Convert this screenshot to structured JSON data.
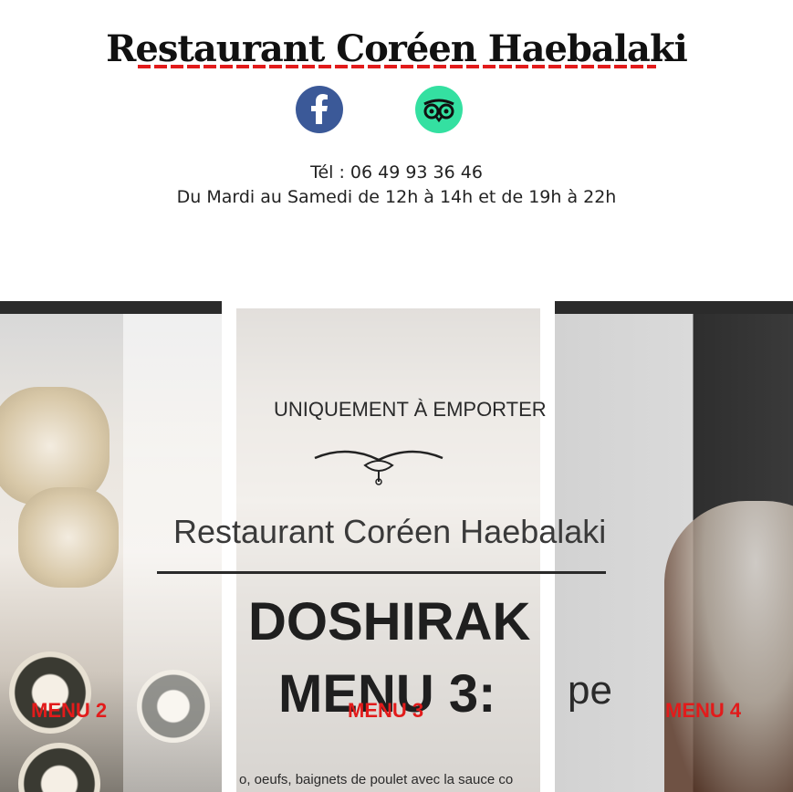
{
  "header": {
    "title": "Restaurant Coréen Haebalaki",
    "phone": "Tél : 06 49 93 36 46",
    "hours": "Du Mardi au Samedi de 12h à 14h et de 19h à 22h"
  },
  "social": [
    {
      "name": "facebook-icon",
      "glyph": "f",
      "color": "#3b5998"
    },
    {
      "name": "tripadvisor-icon",
      "glyph": "owl",
      "color": "#34e0a1"
    }
  ],
  "gallery": {
    "overlay": {
      "takeaway": "UNIQUEMENT À EMPORTER",
      "restaurant": "Restaurant Coréen Haebalaki",
      "doshirak": "DOSHIRAK",
      "menu_heading": "MENU 3:",
      "partial_word": "pe",
      "description": "o, oeufs, baignets de poulet avec la sauce co"
    },
    "labels": [
      "MENU 2",
      "MENU 3",
      "MENU 4"
    ]
  }
}
